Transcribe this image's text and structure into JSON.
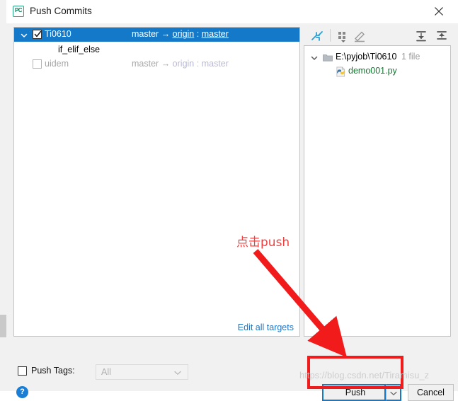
{
  "window": {
    "title": "Push Commits",
    "app_icon": "pycharm-icon",
    "app_icon_text": "PC",
    "close_icon": "close-icon"
  },
  "commit_panel": {
    "repositories": [
      {
        "name": "Ti0610",
        "checked": true,
        "selected": true,
        "expanded": true,
        "source_branch": "master",
        "arrow": "→",
        "remote": "origin",
        "separator": ":",
        "target_branch": "master",
        "commits": [
          {
            "message": "if_elif_else"
          }
        ]
      },
      {
        "name": "uidem",
        "checked": false,
        "selected": false,
        "expanded": false,
        "source_branch": "master",
        "arrow": "→",
        "remote": "origin",
        "separator": ":",
        "target_branch": "master",
        "commits": []
      }
    ],
    "edit_all_targets_label": "Edit all targets"
  },
  "file_toolbar": {
    "buttons": [
      {
        "name": "collapse-arrows-icon",
        "tooltip": ""
      },
      {
        "name": "group-by-icon",
        "tooltip": ""
      },
      {
        "name": "edit-pencil-icon",
        "tooltip": ""
      },
      {
        "name": "expand-all-icon",
        "tooltip": ""
      },
      {
        "name": "collapse-all-icon",
        "tooltip": ""
      }
    ]
  },
  "file_panel": {
    "directory": {
      "path": "E:\\pyjob\\Ti0610",
      "count_label": "1 file",
      "expanded": true,
      "icon": "folder-icon"
    },
    "files": [
      {
        "name": "demo001.py",
        "icon": "python-file-icon"
      }
    ]
  },
  "bottom_bar": {
    "push_tags_label": "Push Tags:",
    "push_tags_mnemonic": "T",
    "push_tags_checked": false,
    "tags_combo_value": "All",
    "tags_combo_enabled": false,
    "help_icon": "help-icon",
    "help_glyph": "?",
    "push_label": "Push",
    "push_mnemonic": "P",
    "push_split_icon": "chevron-down-icon",
    "cancel_label": "Cancel"
  },
  "annotations": {
    "text": "点击push",
    "text_color": "#f04040",
    "arrow_color": "#f21b1b",
    "highlight_color": "#f21b1b",
    "watermark": "https://blog.csdn.net/Tiramisu_z"
  },
  "colors": {
    "selection_blue": "#1379c8",
    "link_blue": "#2176c7",
    "accent_green": "#0f7a2f",
    "disabled_gray": "#a6a6a6"
  }
}
